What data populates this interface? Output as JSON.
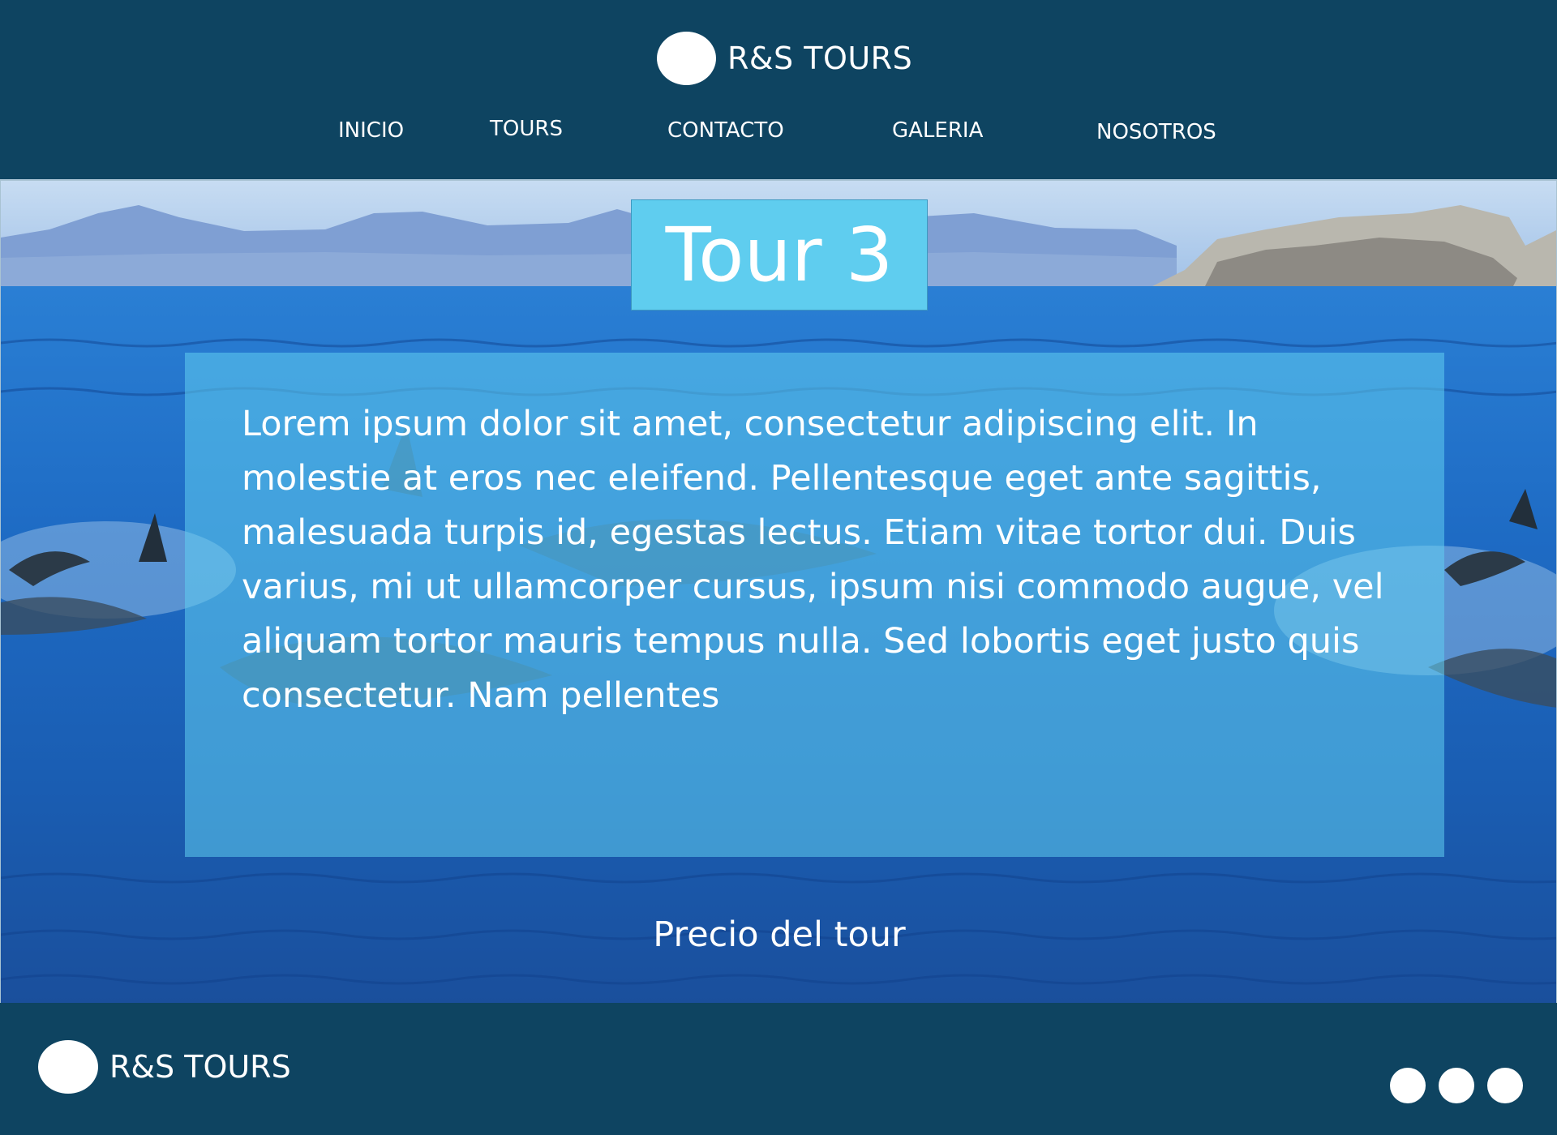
{
  "header": {
    "brand_name": "R&S TOURS",
    "nav": [
      {
        "label": "INICIO"
      },
      {
        "label": "TOURS"
      },
      {
        "label": "CONTACTO"
      },
      {
        "label": "GALERIA"
      },
      {
        "label": "NOSOTROS"
      }
    ]
  },
  "hero": {
    "title": "Tour 3",
    "description": "Lorem ipsum dolor sit amet, consectetur adipiscing elit. In molestie at eros nec eleifend. Pellentesque eget ante sagittis, malesuada turpis id, egestas lectus. Etiam vitae tortor dui. Duis varius, mi ut ullamcorper cursus, ipsum nisi commodo augue, vel aliquam tortor mauris tempus nulla. Sed lobortis eget justo quis consectetur. Nam pellentes",
    "price_label": "Precio del tour"
  },
  "footer": {
    "brand_name": "R&S TOURS",
    "social_icons": [
      "social-icon-1",
      "social-icon-2",
      "social-icon-3"
    ]
  },
  "colors": {
    "header_bg": "#0e4461",
    "title_box_bg": "#5fcdef",
    "text": "#ffffff"
  }
}
